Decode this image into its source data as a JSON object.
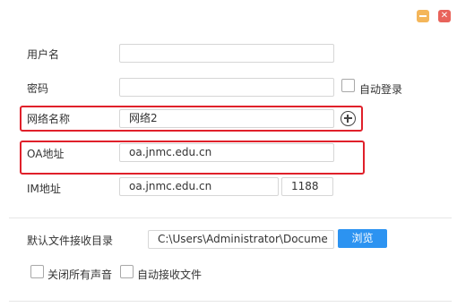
{
  "window": {
    "minimize_icon": "minimize-icon",
    "close_icon": "close-icon",
    "close_glyph": "✕",
    "minimize_color": "#f4b65a",
    "close_color": "#e8635b"
  },
  "form": {
    "username_label": "用户名",
    "username_value": "",
    "password_label": "密码",
    "password_value": "",
    "auto_login_label": "自动登录",
    "auto_login_checked": false,
    "network_label": "网络名称",
    "network_value": "网络2",
    "add_network_icon": "plus-circle-icon",
    "oa_label": "OA地址",
    "oa_value": "oa.jnmc.edu.cn",
    "im_label": "IM地址",
    "im_value": "oa.jnmc.edu.cn",
    "im_port": "1188"
  },
  "files": {
    "dir_label": "默认文件接收目录",
    "dir_value": "C:\\Users\\Administrator\\Docume",
    "browse_label": "浏览",
    "mute_label": "关闭所有声音",
    "mute_checked": false,
    "auto_receive_label": "自动接收文件",
    "auto_receive_checked": false
  },
  "colors": {
    "highlight": "#e0202a",
    "accent": "#2c93f1"
  }
}
